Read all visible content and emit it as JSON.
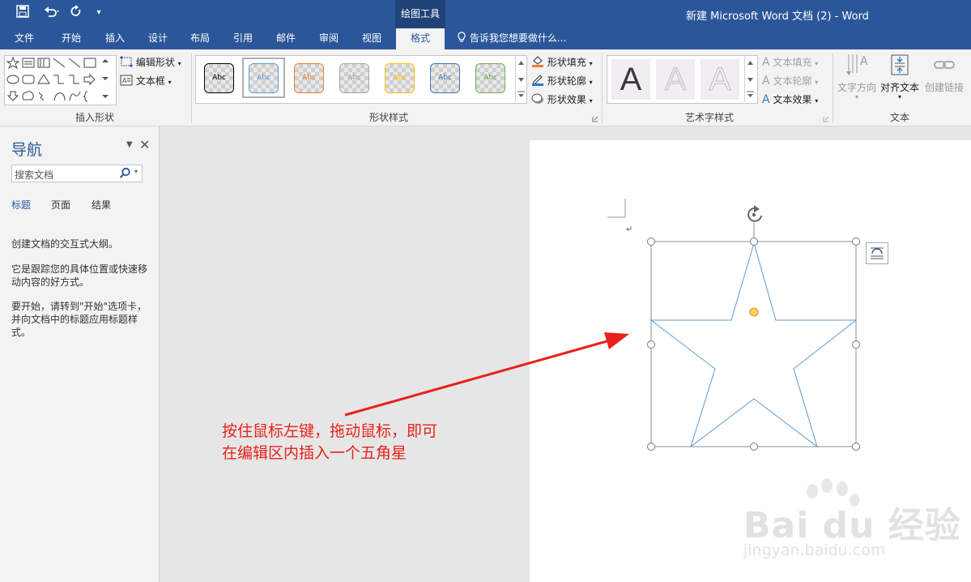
{
  "window": {
    "title": "新建 Microsoft Word 文档 (2) - Word",
    "contextual_tab": "绘图工具"
  },
  "ribbon": {
    "tabs": [
      "文件",
      "开始",
      "插入",
      "设计",
      "布局",
      "引用",
      "邮件",
      "审阅",
      "视图",
      "格式"
    ],
    "active_tab": "格式",
    "tell_me": "告诉我您想要做什么...",
    "groups": {
      "insert_shapes": {
        "label": "插入形状",
        "edit_shape": "编辑形状",
        "text_box": "文本框"
      },
      "shape_styles": {
        "label": "形状样式",
        "swatch_text": "Abc",
        "swatch_colors": [
          "#000000",
          "#5b9bd5",
          "#ed7d31",
          "#a5a5a5",
          "#ffc000",
          "#4472c4",
          "#70ad47"
        ],
        "fill": "形状填充",
        "outline": "形状轮廓",
        "effects": "形状效果"
      },
      "wordart_styles": {
        "label": "艺术字样式",
        "letter": "A",
        "text_fill": "文本填充",
        "text_outline": "文本轮廓",
        "text_effects": "文本效果"
      },
      "text": {
        "label": "文本",
        "direction": "文字方向",
        "align": "对齐文本",
        "link": "创建链接"
      }
    }
  },
  "nav": {
    "title": "导航",
    "search_placeholder": "搜索文档",
    "tabs": [
      "标题",
      "页面",
      "结果"
    ],
    "help": [
      "创建文档的交互式大纲。",
      "它是跟踪您的具体位置或快速移动内容的好方式。",
      "要开始，请转到\"开始\"选项卡，并向文档中的标题应用标题样式。"
    ]
  },
  "document": {
    "annotation_line1": "按住鼠标左键，拖动鼠标，即可",
    "annotation_line2": "在编辑区内插入一个五角星",
    "watermark_main": "Bai du 经验",
    "watermark_url": "jingyan.baidu.com"
  },
  "colors": {
    "brand": "#2b579a",
    "annotation": "#e8211c",
    "star_outline": "#5b9bd5"
  }
}
